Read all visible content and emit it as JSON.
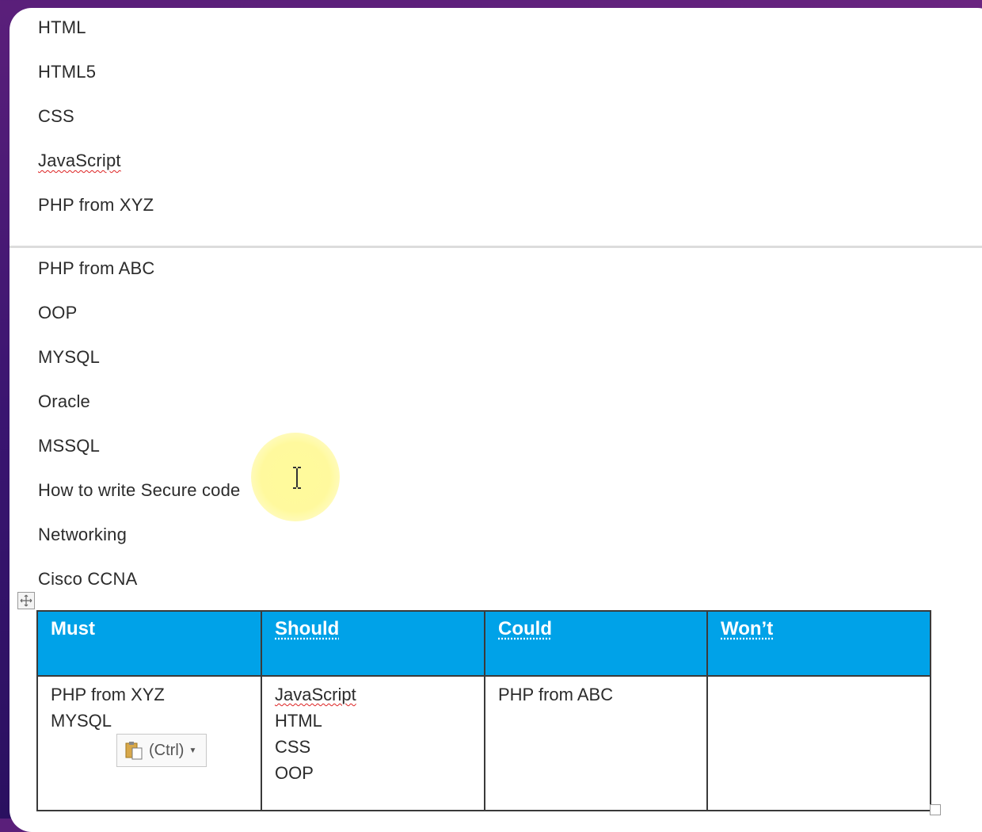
{
  "document_lines_page1": [
    "HTML",
    "HTML5",
    "CSS",
    "JavaScript",
    "PHP from XYZ"
  ],
  "document_lines_page2": [
    "PHP from ABC",
    "OOP",
    "MYSQL",
    "Oracle",
    "MSSQL",
    "How to write Secure code",
    "Networking",
    "Cisco CCNA"
  ],
  "table": {
    "headers": [
      "Must",
      "Should",
      "Could",
      "Won’t"
    ],
    "cells": [
      [
        "PHP from XYZ",
        "MYSQL"
      ],
      [
        "JavaScript",
        "HTML",
        "CSS",
        "OOP"
      ],
      [
        "PHP from ABC"
      ],
      []
    ]
  },
  "paste_options": {
    "label": "(Ctrl)"
  },
  "colors": {
    "header_bg": "#00a2e8",
    "header_text": "#ffffff",
    "highlight": "#fff58a"
  }
}
